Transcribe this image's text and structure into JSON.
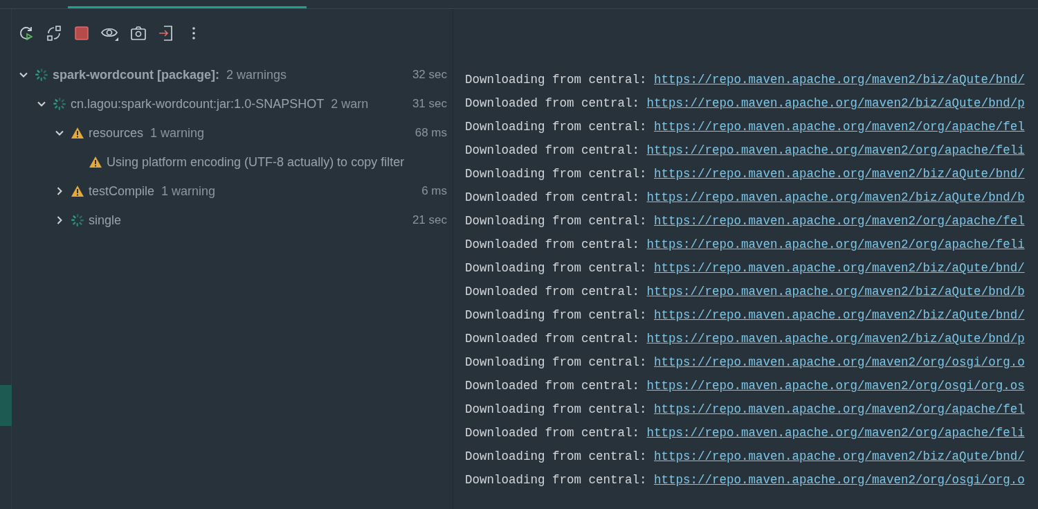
{
  "tab_strip": {
    "tabs": [
      {
        "selected": true
      }
    ]
  },
  "toolbar": {
    "buttons": [
      {
        "kind": "rerun"
      },
      {
        "kind": "toggle"
      },
      {
        "kind": "stop"
      },
      {
        "kind": "eye"
      },
      {
        "kind": "camera"
      },
      {
        "kind": "exit"
      },
      {
        "kind": "more"
      }
    ]
  },
  "sidebar": {
    "items": [
      {
        "selected": true
      }
    ]
  },
  "tree": [
    {
      "kind": "spinner",
      "label": "spark-wordcount [package]:",
      "bold": true,
      "detail": "2 warnings",
      "time": "32 sec",
      "expanded": true,
      "children": [
        {
          "kind": "spinner",
          "label": "cn.lagou:spark-wordcount:jar:1.0-SNAPSHOT",
          "bold": false,
          "detail": "2 warn",
          "time": "31 sec",
          "expanded": true,
          "children": [
            {
              "kind": "warning",
              "label": "resources",
              "bold": false,
              "detail": "1 warning",
              "time": "68 ms",
              "expanded": true,
              "children": [
                {
                  "kind": "warning",
                  "label": "Using platform encoding (UTF-8 actually) to copy filter",
                  "bold": false
                }
              ]
            },
            {
              "kind": "warning",
              "label": "testCompile",
              "bold": false,
              "detail": "1 warning",
              "time": "6 ms",
              "expanded": false
            },
            {
              "kind": "spinner",
              "label": "single",
              "bold": false,
              "time": "21 sec",
              "expanded": false
            }
          ]
        }
      ]
    }
  ],
  "console": [
    {
      "prefix": "Downloading from central:",
      "link": "https://repo.maven.apache.org/maven2/biz/aQute/bnd/"
    },
    {
      "prefix": "Downloaded from central:",
      "link": "https://repo.maven.apache.org/maven2/biz/aQute/bnd/p"
    },
    {
      "prefix": "Downloading from central:",
      "link": "https://repo.maven.apache.org/maven2/org/apache/fel"
    },
    {
      "prefix": "Downloaded from central:",
      "link": "https://repo.maven.apache.org/maven2/org/apache/feli"
    },
    {
      "prefix": "Downloading from central:",
      "link": "https://repo.maven.apache.org/maven2/biz/aQute/bnd/"
    },
    {
      "prefix": "Downloaded from central:",
      "link": "https://repo.maven.apache.org/maven2/biz/aQute/bnd/b"
    },
    {
      "prefix": "Downloading from central:",
      "link": "https://repo.maven.apache.org/maven2/org/apache/fel"
    },
    {
      "prefix": "Downloaded from central:",
      "link": "https://repo.maven.apache.org/maven2/org/apache/feli"
    },
    {
      "prefix": "Downloading from central:",
      "link": "https://repo.maven.apache.org/maven2/biz/aQute/bnd/"
    },
    {
      "prefix": "Downloaded from central:",
      "link": "https://repo.maven.apache.org/maven2/biz/aQute/bnd/b"
    },
    {
      "prefix": "Downloading from central:",
      "link": "https://repo.maven.apache.org/maven2/biz/aQute/bnd/"
    },
    {
      "prefix": "Downloaded from central:",
      "link": "https://repo.maven.apache.org/maven2/biz/aQute/bnd/p"
    },
    {
      "prefix": "Downloading from central:",
      "link": "https://repo.maven.apache.org/maven2/org/osgi/org.o"
    },
    {
      "prefix": "Downloaded from central:",
      "link": "https://repo.maven.apache.org/maven2/org/osgi/org.os"
    },
    {
      "prefix": "Downloading from central:",
      "link": "https://repo.maven.apache.org/maven2/org/apache/fel"
    },
    {
      "prefix": "Downloaded from central:",
      "link": "https://repo.maven.apache.org/maven2/org/apache/feli"
    },
    {
      "prefix": "Downloading from central:",
      "link": "https://repo.maven.apache.org/maven2/biz/aQute/bnd/"
    },
    {
      "prefix": "Downloading from central:",
      "link": "https://repo.maven.apache.org/maven2/org/osgi/org.o"
    }
  ]
}
